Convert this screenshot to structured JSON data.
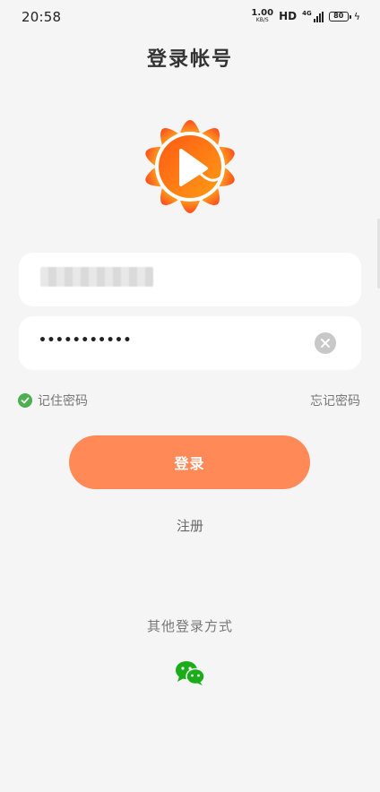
{
  "status_bar": {
    "time": "20:58",
    "net_speed_value": "1.00",
    "net_speed_unit": "KB/S",
    "hd_label": "HD",
    "signal_label": "4G",
    "battery_level": "80"
  },
  "page": {
    "title": "登录帐号"
  },
  "form": {
    "password_masked": "•••••••••••",
    "remember_label": "记住密码",
    "forgot_label": "忘记密码",
    "login_label": "登录",
    "register_label": "注册"
  },
  "other_login": {
    "label": "其他登录方式",
    "icons": [
      "wechat-icon"
    ]
  },
  "colors": {
    "background": "#f5f5f5",
    "accent": "#ff8a57",
    "logo_orange": "#ff6a1a",
    "check_green": "#4caf50",
    "wechat_green": "#1aad19"
  },
  "icons": {
    "logo": "sunflower-play-logo",
    "clear": "clear-icon",
    "remember": "check-circle-icon",
    "wechat": "wechat-icon"
  }
}
